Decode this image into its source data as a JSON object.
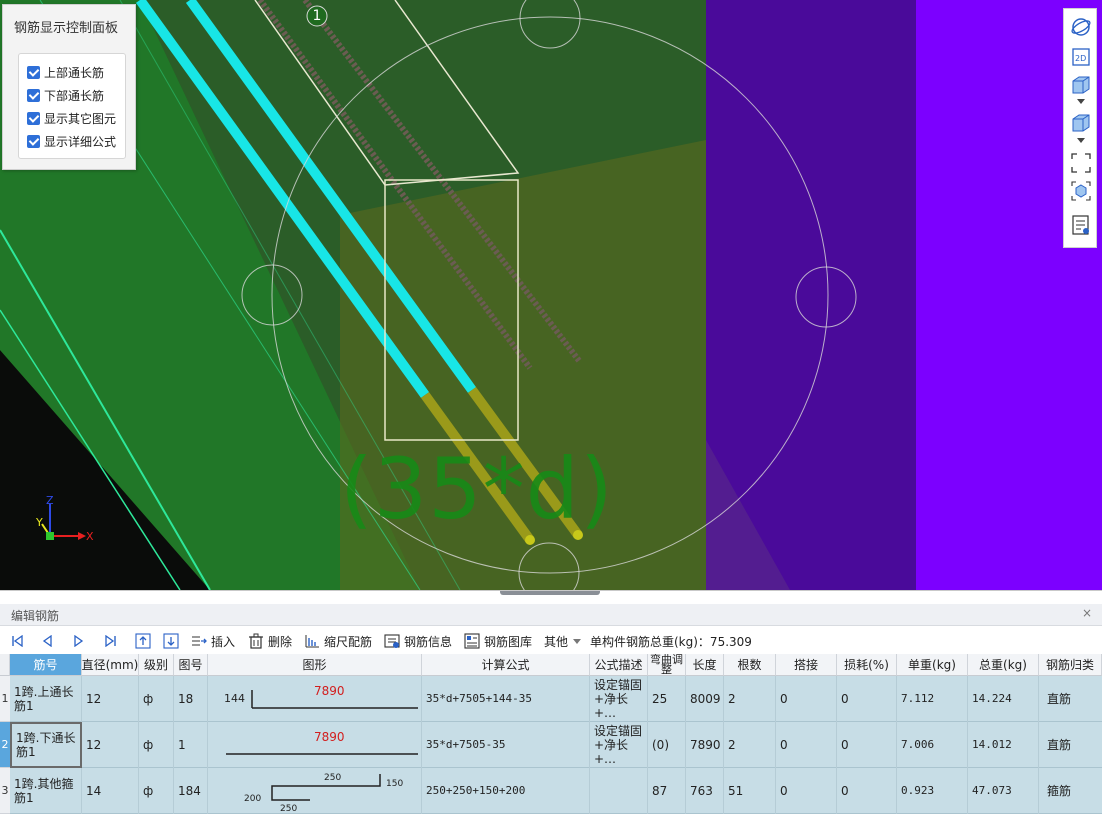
{
  "viewport": {
    "control_panel": {
      "title": "钢筋显示控制面板",
      "options": [
        {
          "label": "上部通长筋",
          "checked": true
        },
        {
          "label": "下部通长筋",
          "checked": true
        },
        {
          "label": "显示其它图元",
          "checked": true
        },
        {
          "label": "显示详细公式",
          "checked": true
        }
      ]
    },
    "span_marker": "1",
    "anchor_label": "(35*d)",
    "axis": {
      "x": "X",
      "y": "Y",
      "z": "Z"
    },
    "right_toolbar": [
      "orbit-icon",
      "view-2d-icon",
      "view-3d-icon",
      "view-3d-alt-icon",
      "fit-view-icon",
      "box-view-icon",
      "rebar-list-icon"
    ],
    "right_toolbar_2d_text": "2D",
    "colors": {
      "cyan_bar": "#18e6e6",
      "olive_bar": "#9a9a1a",
      "purple_wall": "#7c00ff",
      "green_beam": "#2f6b2f",
      "label_green": "#178a17"
    }
  },
  "editor": {
    "title": "编辑钢筋",
    "close": "×",
    "toolbar": {
      "insert": "插入",
      "delete": "删除",
      "scale_rebar": "缩尺配筋",
      "rebar_info": "钢筋信息",
      "rebar_library": "钢筋图库",
      "other": "其他",
      "total_weight": "单构件钢筋总重(kg)：75.309"
    },
    "columns": [
      "筋号",
      "直径(mm)",
      "级别",
      "图号",
      "图形",
      "计算公式",
      "公式描述",
      "弯曲调整",
      "长度",
      "根数",
      "搭接",
      "损耗(%)",
      "单重(kg)",
      "总重(kg)",
      "钢筋归类"
    ],
    "rows": [
      {
        "num": "1",
        "name": "1跨.上通长筋1",
        "diameter": "12",
        "grade": "ф",
        "fig_no": "18",
        "shape_left": "144",
        "shape_length": "7890",
        "formula": "35*d+7505+144-35",
        "desc": "设定锚固+净长+…",
        "bend": "25",
        "length": "8009",
        "count": "2",
        "lap": "0",
        "loss": "0",
        "unit_weight": "7.112",
        "total_weight": "14.224",
        "category": "直筋"
      },
      {
        "num": "2",
        "name": "1跨.下通长筋1",
        "diameter": "12",
        "grade": "ф",
        "fig_no": "1",
        "shape_length": "7890",
        "formula": "35*d+7505-35",
        "desc": "设定锚固+净长+…",
        "bend": "(0)",
        "length": "7890",
        "count": "2",
        "lap": "0",
        "loss": "0",
        "unit_weight": "7.006",
        "total_weight": "14.012",
        "category": "直筋"
      },
      {
        "num": "3",
        "name": "1跨.其他箍筋1",
        "diameter": "14",
        "grade": "ф",
        "fig_no": "184",
        "shape_top": "250",
        "shape_right": "150",
        "shape_left": "200",
        "shape_bottom": "250",
        "formula": "250+250+150+200",
        "desc": "",
        "bend": "87",
        "length": "763",
        "count": "51",
        "lap": "0",
        "loss": "0",
        "unit_weight": "0.923",
        "total_weight": "47.073",
        "category": "箍筋"
      }
    ]
  }
}
